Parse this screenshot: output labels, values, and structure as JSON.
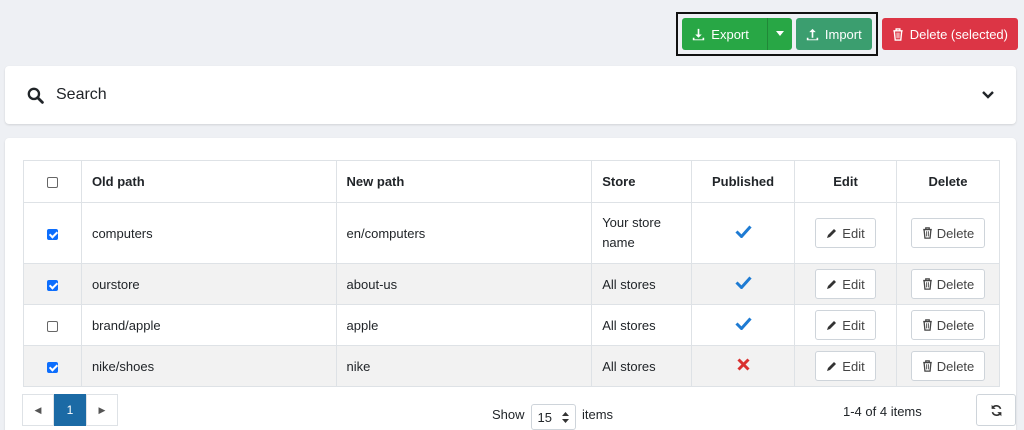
{
  "toolbar": {
    "export_label": "Export",
    "import_label": "Import",
    "delete_selected_label": "Delete (selected)"
  },
  "search": {
    "label": "Search"
  },
  "table": {
    "headers": {
      "old_path": "Old path",
      "new_path": "New path",
      "store": "Store",
      "published": "Published",
      "edit": "Edit",
      "delete": "Delete"
    },
    "rows": [
      {
        "checked": true,
        "old_path": "computers",
        "new_path": "en/computers",
        "store": "Your store name",
        "published": true,
        "edit": "Edit",
        "delete": "Delete"
      },
      {
        "checked": true,
        "old_path": "ourstore",
        "new_path": "about-us",
        "store": "All stores",
        "published": true,
        "edit": "Edit",
        "delete": "Delete"
      },
      {
        "checked": false,
        "old_path": "brand/apple",
        "new_path": "apple",
        "store": "All stores",
        "published": true,
        "edit": "Edit",
        "delete": "Delete"
      },
      {
        "checked": true,
        "old_path": "nike/shoes",
        "new_path": "nike",
        "store": "All stores",
        "published": false,
        "edit": "Edit",
        "delete": "Delete"
      }
    ]
  },
  "pager": {
    "current_page": "1",
    "show_label": "Show",
    "page_size": "15",
    "items_label": "items",
    "summary": "1-4 of 4 items"
  },
  "colors": {
    "export": "#28a745",
    "import": "#3b9e6f",
    "delete": "#dc3545",
    "check": "#1e7bd3",
    "cross": "#d9302f",
    "active_page": "#1b6aa5"
  }
}
